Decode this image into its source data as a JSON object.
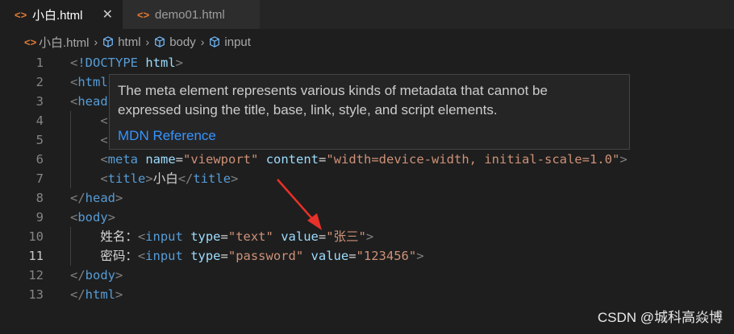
{
  "tabs": [
    {
      "icon": "<>",
      "label": "小白.html",
      "close": "✕"
    },
    {
      "icon": "<>",
      "label": "demo01.html"
    }
  ],
  "breadcrumb": {
    "file": "小白.html",
    "items": [
      "html",
      "body",
      "input"
    ]
  },
  "code_lines": [
    {
      "n": "1",
      "tokens": [
        [
          "punc",
          "<"
        ],
        [
          "tag",
          "!DOCTYPE"
        ],
        [
          "txt",
          " "
        ],
        [
          "attr",
          "html"
        ],
        [
          "punc",
          ">"
        ]
      ]
    },
    {
      "n": "2",
      "tokens": [
        [
          "punc",
          "<"
        ],
        [
          "tag",
          "html"
        ]
      ]
    },
    {
      "n": "3",
      "tokens": [
        [
          "punc",
          "<"
        ],
        [
          "tag",
          "head"
        ]
      ]
    },
    {
      "n": "4",
      "tokens": [
        [
          "txt",
          "    "
        ],
        [
          "punc",
          "<"
        ]
      ]
    },
    {
      "n": "5",
      "tokens": [
        [
          "txt",
          "    "
        ],
        [
          "punc",
          "<"
        ]
      ]
    },
    {
      "n": "6",
      "tokens": [
        [
          "txt",
          "    "
        ],
        [
          "punc",
          "<"
        ],
        [
          "tag",
          "meta"
        ],
        [
          "txt",
          " "
        ],
        [
          "attr",
          "name"
        ],
        [
          "txt",
          "="
        ],
        [
          "str",
          "\"viewport\""
        ],
        [
          "txt",
          " "
        ],
        [
          "attr",
          "content"
        ],
        [
          "txt",
          "="
        ],
        [
          "str",
          "\"width=device-width, initial-scale=1.0\""
        ],
        [
          "punc",
          ">"
        ]
      ]
    },
    {
      "n": "7",
      "tokens": [
        [
          "txt",
          "    "
        ],
        [
          "punc",
          "<"
        ],
        [
          "tag",
          "title"
        ],
        [
          "punc",
          ">"
        ],
        [
          "txt",
          "小白"
        ],
        [
          "punc",
          "</"
        ],
        [
          "tag",
          "title"
        ],
        [
          "punc",
          ">"
        ]
      ]
    },
    {
      "n": "8",
      "tokens": [
        [
          "punc",
          "</"
        ],
        [
          "tag",
          "head"
        ],
        [
          "punc",
          ">"
        ]
      ]
    },
    {
      "n": "9",
      "tokens": [
        [
          "punc",
          "<"
        ],
        [
          "tag",
          "body"
        ],
        [
          "punc",
          ">"
        ]
      ]
    },
    {
      "n": "10",
      "tokens": [
        [
          "txt",
          "    姓名："
        ],
        [
          "punc",
          "<"
        ],
        [
          "tag",
          "input"
        ],
        [
          "txt",
          " "
        ],
        [
          "attr",
          "type"
        ],
        [
          "txt",
          "="
        ],
        [
          "str",
          "\"text\""
        ],
        [
          "txt",
          " "
        ],
        [
          "attr",
          "value"
        ],
        [
          "txt",
          "="
        ],
        [
          "str",
          "\"张三\""
        ],
        [
          "punc",
          ">"
        ]
      ]
    },
    {
      "n": "11",
      "tokens": [
        [
          "txt",
          "    密码："
        ],
        [
          "punc",
          "<"
        ],
        [
          "tag",
          "input"
        ],
        [
          "txt",
          " "
        ],
        [
          "attr",
          "type"
        ],
        [
          "txt",
          "="
        ],
        [
          "str",
          "\"password\""
        ],
        [
          "txt",
          " "
        ],
        [
          "attr",
          "value"
        ],
        [
          "txt",
          "="
        ],
        [
          "str",
          "\"123456\""
        ],
        [
          "punc",
          ">"
        ]
      ]
    },
    {
      "n": "12",
      "tokens": [
        [
          "punc",
          "</"
        ],
        [
          "tag",
          "body"
        ],
        [
          "punc",
          ">"
        ]
      ]
    },
    {
      "n": "13",
      "tokens": [
        [
          "punc",
          "</"
        ],
        [
          "tag",
          "html"
        ],
        [
          "punc",
          ">"
        ]
      ]
    }
  ],
  "current_line": "11",
  "hover": {
    "description": "The meta element represents various kinds of metadata that cannot be expressed using the title, base, link, style, and script elements.",
    "link": "MDN Reference"
  },
  "watermark": "CSDN @城科高焱博",
  "colors": {
    "arrow": "#e8312a",
    "link": "#3794ff",
    "tag": "#569cd6",
    "attr": "#9cdcfe",
    "string": "#ce9178"
  }
}
